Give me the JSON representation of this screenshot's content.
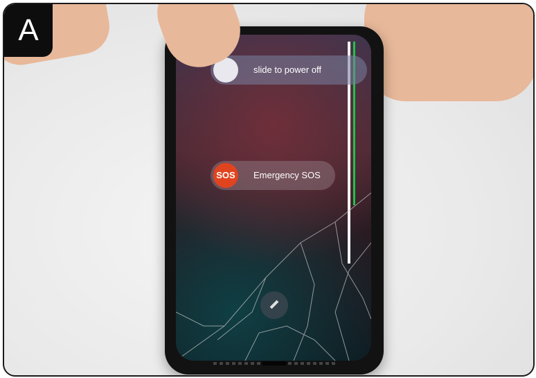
{
  "step": {
    "letter": "A"
  },
  "screen": {
    "power_slider_label": "slide to power off",
    "sos_knob_label": "SOS",
    "sos_slider_label": "Emergency SOS"
  },
  "colors": {
    "sos_red": "#e0441f",
    "display_fault_green": "#1fc24b",
    "frame_border": "#1a1a1a"
  }
}
